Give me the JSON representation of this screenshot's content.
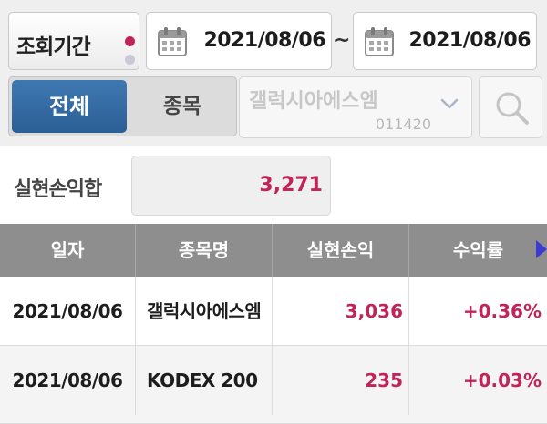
{
  "filter": {
    "period_label": "조회기간",
    "date_from": "2021/08/06",
    "separator": "~",
    "date_to": "2021/08/06",
    "tabs": [
      "전체",
      "종목"
    ],
    "selected_tab": "전체",
    "stock_name": "갤럭시아에스엠",
    "stock_code": "011420",
    "icons": {
      "calendar": "calendar-icon",
      "dropdown": "chevron-down-icon",
      "search": "search-icon"
    }
  },
  "summary": {
    "label": "실현손익합",
    "value": "3,271"
  },
  "table": {
    "columns": [
      "일자",
      "종목명",
      "실현손익",
      "수익률"
    ],
    "rows": [
      {
        "date": "2021/08/06",
        "name": "갤럭시아에스엠",
        "pl": "3,036",
        "rate": "+0.36%"
      },
      {
        "date": "2021/08/06",
        "name": "KODEX 200",
        "pl": "235",
        "rate": "+0.03%"
      }
    ]
  },
  "colors": {
    "accent_blue": "#2b5f95",
    "profit_red": "#c1245b",
    "header_gray": "#8e8e8e",
    "scroll_arrow": "#3d3ad0"
  }
}
